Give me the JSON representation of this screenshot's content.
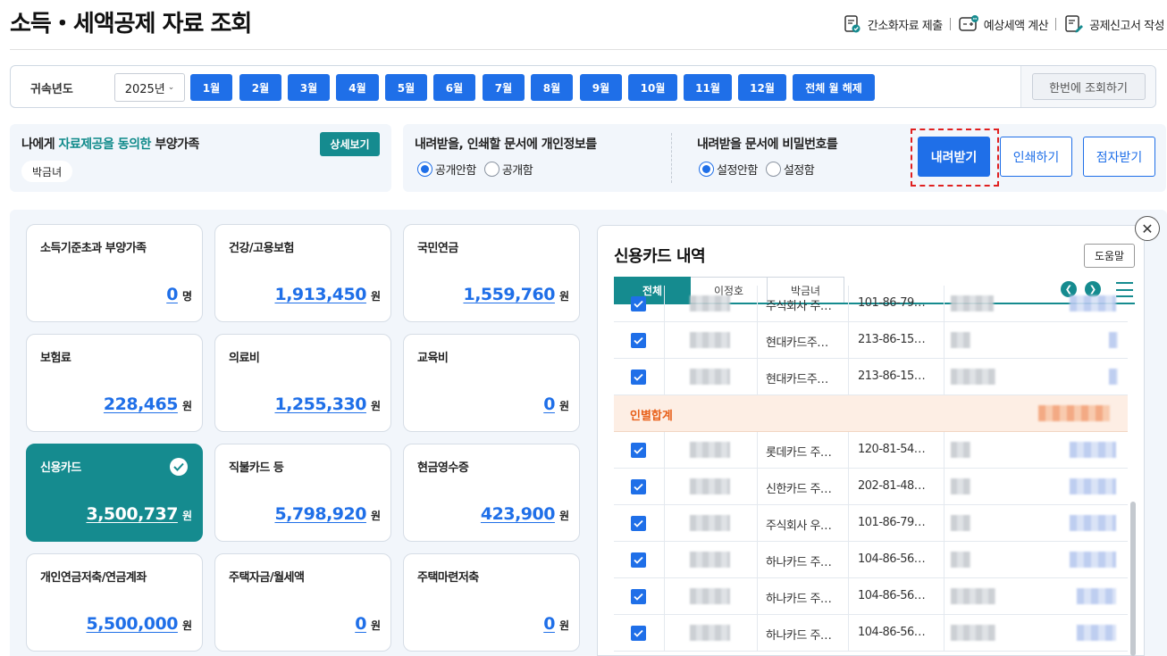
{
  "header": {
    "title": "소득・세액공제 자료 조회",
    "links": [
      {
        "label": "간소화자료 제출",
        "icon": "document-check-icon"
      },
      {
        "label": "예상세액 계산",
        "icon": "calculator-chat-icon"
      },
      {
        "label": "공제신고서 작성",
        "icon": "document-edit-icon"
      }
    ]
  },
  "year_bar": {
    "label": "귀속년도",
    "selected_year": "2025년",
    "months": [
      "1월",
      "2월",
      "3월",
      "4월",
      "5월",
      "6월",
      "7월",
      "8월",
      "9월",
      "10월",
      "11월",
      "12월"
    ],
    "clear_all": "전체 월 해제",
    "query_all": "한번에 조회하기"
  },
  "dependents": {
    "title_prefix": "나에게",
    "title_highlight": "자료제공을 동의한",
    "title_suffix": "부양가족",
    "detail_button": "상세보기",
    "people": [
      "박금녀"
    ]
  },
  "download_options": {
    "personal_info": {
      "title": "내려받을, 인쇄할 문서에 개인정보를",
      "options": [
        "공개안함",
        "공개함"
      ],
      "selected": "공개안함"
    },
    "password": {
      "title": "내려받을 문서에 비밀번호를",
      "options": [
        "설정안함",
        "설정함"
      ],
      "selected": "설정안함"
    },
    "buttons": {
      "download": "내려받기",
      "print": "인쇄하기",
      "braille": "점자받기"
    }
  },
  "cards": [
    {
      "title": "소득기준초과 부양가족",
      "value": "0",
      "unit": "명",
      "active": false
    },
    {
      "title": "건강/고용보험",
      "value": "1,913,450",
      "unit": "원",
      "active": false
    },
    {
      "title": "국민연금",
      "value": "1,559,760",
      "unit": "원",
      "active": false
    },
    {
      "title": "보험료",
      "value": "228,465",
      "unit": "원",
      "active": false
    },
    {
      "title": "의료비",
      "value": "1,255,330",
      "unit": "원",
      "active": false
    },
    {
      "title": "교육비",
      "value": "0",
      "unit": "원",
      "active": false
    },
    {
      "title": "신용카드",
      "value": "3,500,737",
      "unit": "원",
      "active": true
    },
    {
      "title": "직불카드 등",
      "value": "5,798,920",
      "unit": "원",
      "active": false
    },
    {
      "title": "현금영수증",
      "value": "423,900",
      "unit": "원",
      "active": false
    },
    {
      "title": "개인연금저축/연금계좌",
      "value": "5,500,000",
      "unit": "원",
      "active": false
    },
    {
      "title": "주택자금/월세액",
      "value": "0",
      "unit": "원",
      "active": false
    },
    {
      "title": "주택마련저축",
      "value": "0",
      "unit": "원",
      "active": false
    }
  ],
  "detail": {
    "title": "신용카드 내역",
    "help_button": "도움말",
    "tabs": [
      "전체",
      "이정호",
      "박금녀"
    ],
    "active_tab": "전체",
    "subtotal_label": "인별합계",
    "rows": [
      {
        "company": "주식회사 주…",
        "biz_no": "101-86-79…",
        "checked": true
      },
      {
        "company": "현대카드주…",
        "biz_no": "213-86-15…",
        "checked": true
      },
      {
        "company": "현대카드주…",
        "biz_no": "213-86-15…",
        "checked": true
      },
      {
        "company": "롯데카드 주…",
        "biz_no": "120-81-54…",
        "checked": true
      },
      {
        "company": "신한카드 주…",
        "biz_no": "202-81-48…",
        "checked": true
      },
      {
        "company": "주식회사 우…",
        "biz_no": "101-86-79…",
        "checked": true
      },
      {
        "company": "하나카드 주…",
        "biz_no": "104-86-56…",
        "checked": true
      },
      {
        "company": "하나카드 주…",
        "biz_no": "104-86-56…",
        "checked": true
      },
      {
        "company": "하나카드 주…",
        "biz_no": "104-86-56…",
        "checked": true
      }
    ]
  }
}
